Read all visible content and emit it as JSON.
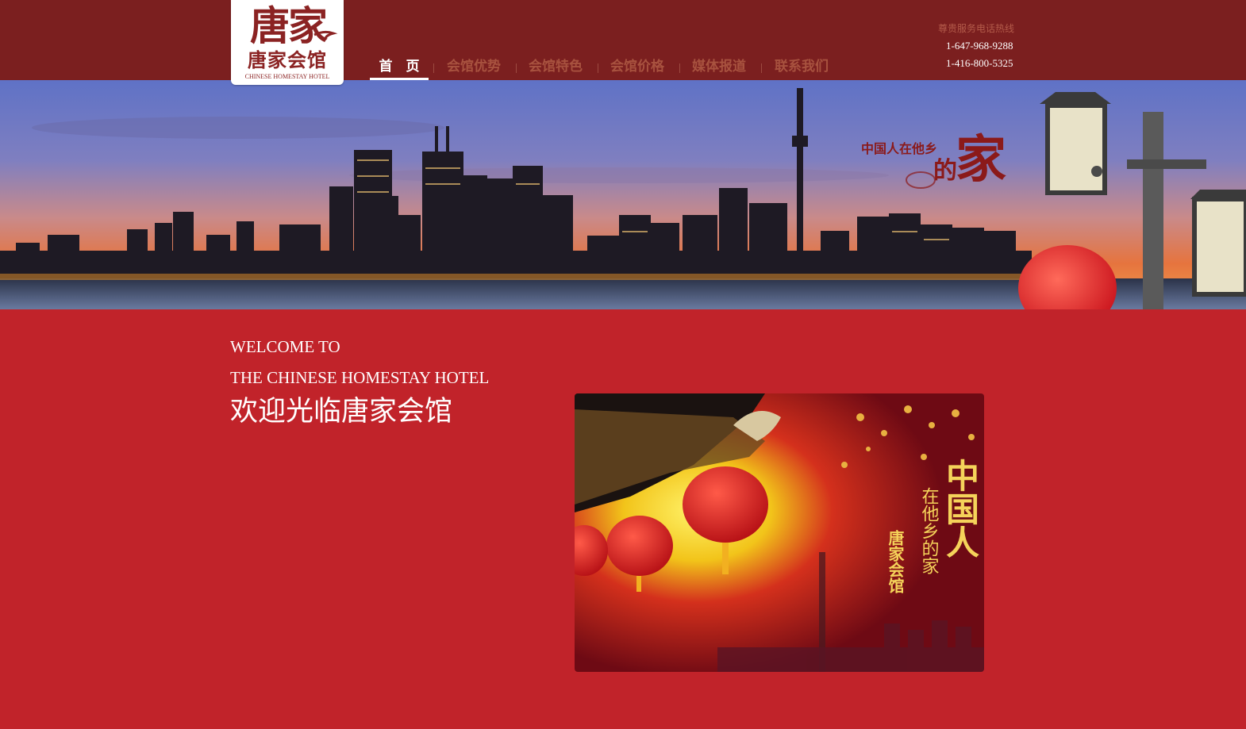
{
  "header": {
    "logo": {
      "mark": "唐家",
      "chinese_name": "唐家会馆",
      "english_name": "CHINESE HOMESTAY HOTEL"
    },
    "nav": [
      {
        "label": "首　页",
        "active": true
      },
      {
        "label": "会馆优势",
        "active": false
      },
      {
        "label": "会馆特色",
        "active": false
      },
      {
        "label": "会馆价格",
        "active": false
      },
      {
        "label": "媒体报道",
        "active": false
      },
      {
        "label": "联系我们",
        "active": false
      }
    ],
    "hotline": {
      "title": "尊贵服务电话热线",
      "phones": [
        "1-647-968-9288",
        "1-416-800-5325"
      ]
    }
  },
  "banner": {
    "tagline_small": "中国人在他乡",
    "tagline_de": "的",
    "tagline_big": "家"
  },
  "main": {
    "welcome_line1": "WELCOME TO",
    "welcome_line2": "THE CHINESE HOMESTAY HOTEL",
    "welcome_cn": "欢迎光临唐家会馆",
    "promo": {
      "title_big": "中国人",
      "title_script": "在他乡的家",
      "brand_vertical": "唐家会馆"
    }
  },
  "colors": {
    "header_bg": "#7b1f1f",
    "page_bg": "#c1232a",
    "nav_text": "#a8523f",
    "active_nav": "#ffffff"
  }
}
